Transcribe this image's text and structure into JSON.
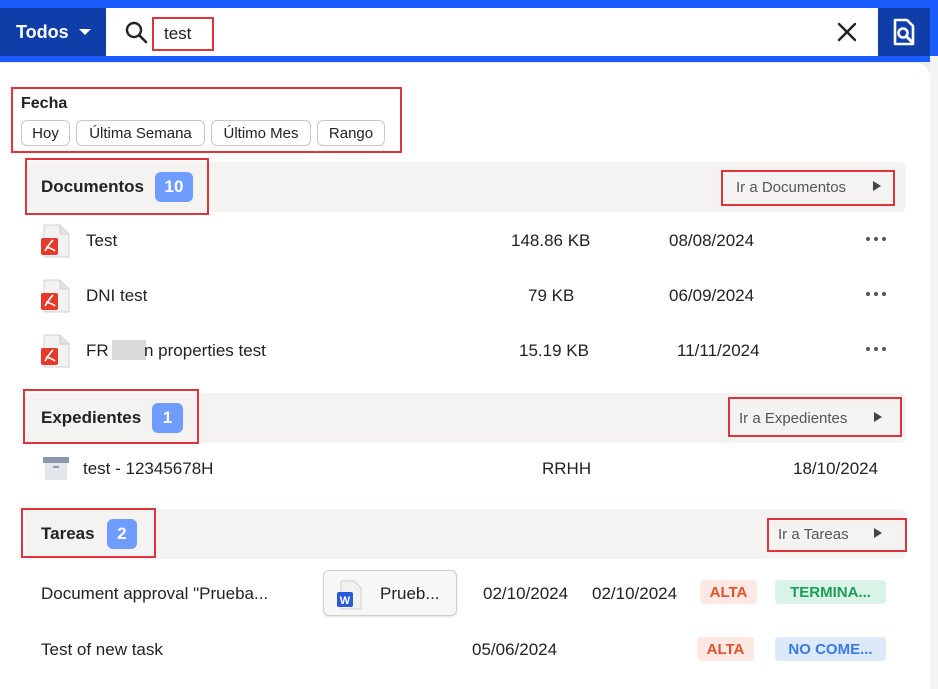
{
  "header": {
    "scope_label": "Todos",
    "search_value": "test"
  },
  "date_filter": {
    "label": "Fecha",
    "chips": [
      "Hoy",
      "Última Semana",
      "Último Mes",
      "Rango"
    ]
  },
  "documents": {
    "title": "Documentos",
    "count": "10",
    "goto_label": "Ir a Documentos",
    "rows": [
      {
        "name": "Test",
        "size": "148.86 KB",
        "date": "08/08/2024",
        "icon": "pdf-icon"
      },
      {
        "name": "DNI test",
        "size": "79 KB",
        "date": "06/09/2024",
        "icon": "pdf-icon"
      },
      {
        "name_prefix": "FR",
        "name_suffix": "n properties test",
        "size": "15.19 KB",
        "date": "11/11/2024",
        "icon": "pdf-icon"
      }
    ]
  },
  "expedientes": {
    "title": "Expedientes",
    "count": "1",
    "goto_label": "Ir a Expedientes",
    "rows": [
      {
        "name": "test - 12345678H",
        "department": "RRHH",
        "date": "18/10/2024",
        "icon": "archive-box-icon"
      }
    ]
  },
  "tasks": {
    "title": "Tareas",
    "count": "2",
    "goto_label": "Ir a Tareas",
    "rows": [
      {
        "name": "Document approval \"Prueba...",
        "attachment": "Prueb...",
        "attachment_icon": "word-doc-icon",
        "start_date": "02/10/2024",
        "end_date": "02/10/2024",
        "priority": "ALTA",
        "status": "TERMINA..."
      },
      {
        "name": "Test of new task",
        "end_date": "05/06/2024",
        "priority": "ALTA",
        "status": "NO COME..."
      }
    ]
  },
  "colors": {
    "accent": "#1a5cff",
    "dark_accent": "#0f3ea8",
    "count_badge": "#6f9cff",
    "priority_high": "#e0522a",
    "status_done": "#1c9b5c",
    "status_not_started": "#3a7be0",
    "annotation_box": "#e0343c"
  }
}
